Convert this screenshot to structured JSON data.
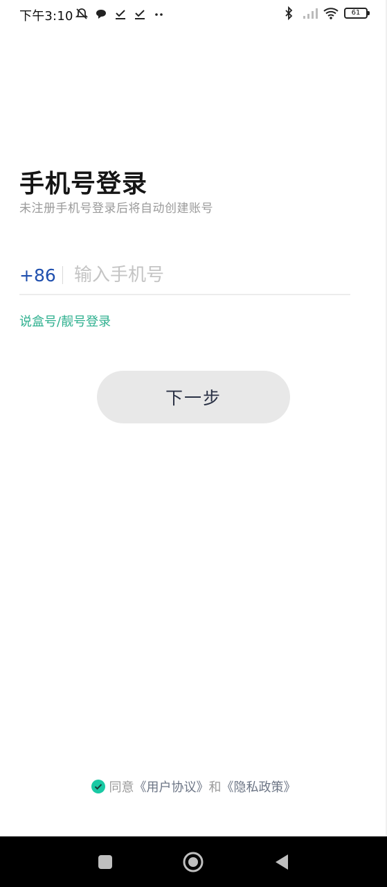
{
  "status_bar": {
    "time": "下午3:10",
    "battery": "61"
  },
  "login": {
    "title": "手机号登录",
    "subtitle": "未注册手机号登录后将自动创建账号",
    "country_code": "+86",
    "phone_placeholder": "输入手机号",
    "phone_value": "",
    "alt_login_label": "说盒号/靓号登录",
    "next_button_label": "下一步"
  },
  "agreement": {
    "prefix": "同意",
    "user_agreement": "《用户协议》",
    "conjunction": "和",
    "privacy_policy": "《隐私政策》",
    "checked": true
  },
  "colors": {
    "accent_blue": "#1f4fae",
    "accent_green": "#2fb08f",
    "check_green": "#19c9a4",
    "button_bg": "#e8e8e8"
  },
  "icons": [
    "mute-bell-icon",
    "chat-bubble-icon",
    "download-done-icon",
    "bluetooth-icon",
    "signal-icon",
    "wifi-icon",
    "battery-icon",
    "check-circle-icon",
    "recents-square-icon",
    "home-circle-icon",
    "back-triangle-icon"
  ]
}
